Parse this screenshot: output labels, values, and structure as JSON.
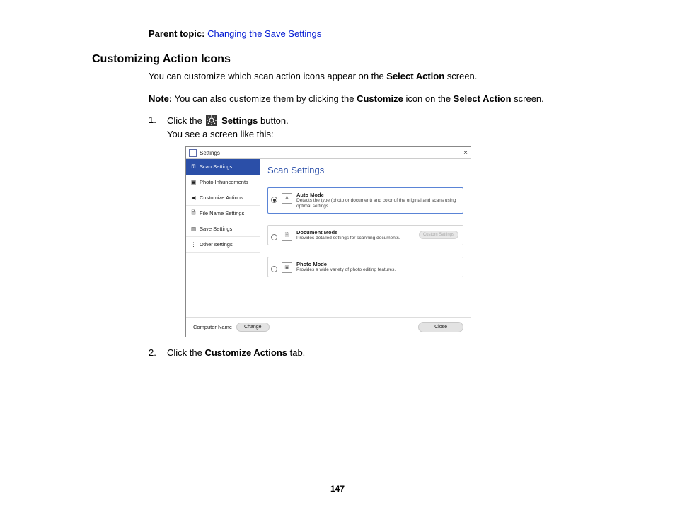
{
  "parent_topic": {
    "label": "Parent topic:",
    "link": "Changing the Save Settings"
  },
  "heading": "Customizing Action Icons",
  "intro": {
    "pre": "You can customize which scan action icons appear on the ",
    "bold1": "Select Action",
    "post": " screen."
  },
  "note": {
    "label": "Note:",
    "t1": " You can also customize them by clicking the ",
    "b1": "Customize",
    "t2": " icon on the ",
    "b2": "Select Action",
    "t3": " screen."
  },
  "steps": [
    {
      "num": "1.",
      "pre": "Click the ",
      "bold": "Settings",
      "post": " button.",
      "sub": "You see a screen like this:"
    },
    {
      "num": "2.",
      "pre": "Click the ",
      "bold": "Customize Actions",
      "post": " tab."
    }
  ],
  "screenshot": {
    "window_title": "Settings",
    "close": "×",
    "sidebar": [
      {
        "label": "Scan Settings",
        "active": true,
        "icon": "scan"
      },
      {
        "label": "Photo Inhuncements",
        "active": false,
        "icon": "photo"
      },
      {
        "label": "Customize Actions",
        "active": false,
        "icon": "send"
      },
      {
        "label": "File Name Settings",
        "active": false,
        "icon": "file"
      },
      {
        "label": "Save Settings",
        "active": false,
        "icon": "save"
      },
      {
        "label": "Other settings",
        "active": false,
        "icon": "dots"
      }
    ],
    "main_title": "Scan Settings",
    "modes": [
      {
        "title": "Auto Mode",
        "desc": "Detects the type (photo or document) and color of the original and scans using optimal settings.",
        "selected": true,
        "btn": ""
      },
      {
        "title": "Document Mode",
        "desc": "Provides detailed settings for scanning documents.",
        "selected": false,
        "btn": "Custom Settings"
      },
      {
        "title": "Photo Mode",
        "desc": "Provides a wide variety of photo editing features.",
        "selected": false,
        "btn": ""
      }
    ],
    "footer": {
      "label": "Computer Name",
      "change": "Change",
      "close": "Close"
    }
  },
  "page_number": "147"
}
